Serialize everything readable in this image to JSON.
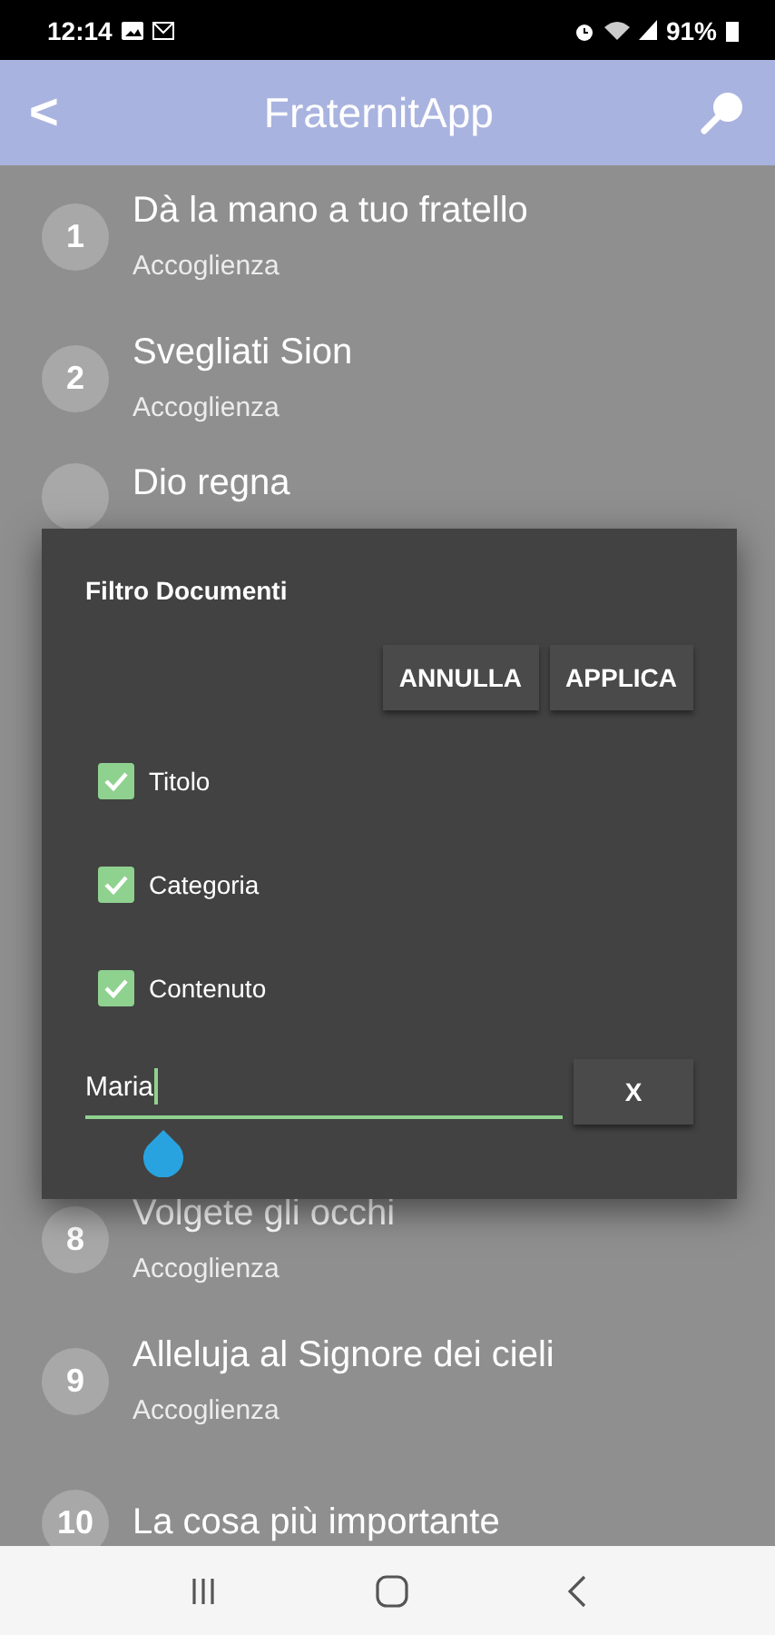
{
  "status_bar": {
    "time": "12:14",
    "battery": "91%"
  },
  "app_bar": {
    "back": "<",
    "title": "FraternitApp"
  },
  "songs_top": [
    {
      "number": "1",
      "title": "Dà la mano a tuo fratello",
      "category": "Accoglienza"
    },
    {
      "number": "2",
      "title": "Svegliati Sion",
      "category": "Accoglienza"
    },
    {
      "title": "Dio regna"
    }
  ],
  "songs_bottom": [
    {
      "number": "8",
      "title": "Volgete gli occhi",
      "category": "Accoglienza"
    },
    {
      "number": "9",
      "title": "Alleluja al Signore dei cieli",
      "category": "Accoglienza"
    },
    {
      "number": "10",
      "title": "La cosa più importante"
    }
  ],
  "dialog": {
    "title": "Filtro Documenti",
    "buttons": [
      "ANNULLA",
      "APPLICA"
    ],
    "options": [
      {
        "label": "Titolo",
        "checked": true
      },
      {
        "label": "Categoria",
        "checked": true
      },
      {
        "label": "Contenuto",
        "checked": true
      }
    ],
    "search_value": "Maria",
    "clear_button": "X"
  }
}
